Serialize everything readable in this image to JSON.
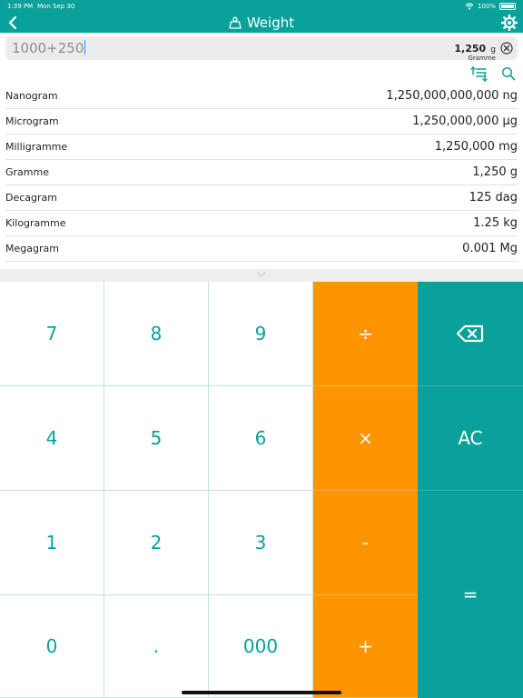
{
  "status": {
    "time": "1:39 PM",
    "date": "Mon Sep 30",
    "battery": "100%"
  },
  "header": {
    "title": "Weight",
    "colors": {
      "teal": "#0aa19a",
      "orange": "#fe9400"
    }
  },
  "input": {
    "expression": "1000+250",
    "result_value": "1,250",
    "result_unit": "g",
    "result_name": "Gramme"
  },
  "units": [
    {
      "label": "Nanogram",
      "value": "1,250,000,000,000 ng"
    },
    {
      "label": "Microgram",
      "value": "1,250,000,000 µg"
    },
    {
      "label": "Milligramme",
      "value": "1,250,000 mg"
    },
    {
      "label": "Gramme",
      "value": "1,250 g"
    },
    {
      "label": "Decagram",
      "value": "125 dag"
    },
    {
      "label": "Kilogramme",
      "value": "1.25 kg"
    },
    {
      "label": "Megagram",
      "value": "0.001 Mg"
    }
  ],
  "keypad": {
    "k7": "7",
    "k8": "8",
    "k9": "9",
    "div": "÷",
    "k4": "4",
    "k5": "5",
    "k6": "6",
    "mul": "×",
    "ac": "AC",
    "k1": "1",
    "k2": "2",
    "k3": "3",
    "minus": "-",
    "k0": "0",
    "dot": ".",
    "k000": "000",
    "plus": "+",
    "eq": "="
  }
}
